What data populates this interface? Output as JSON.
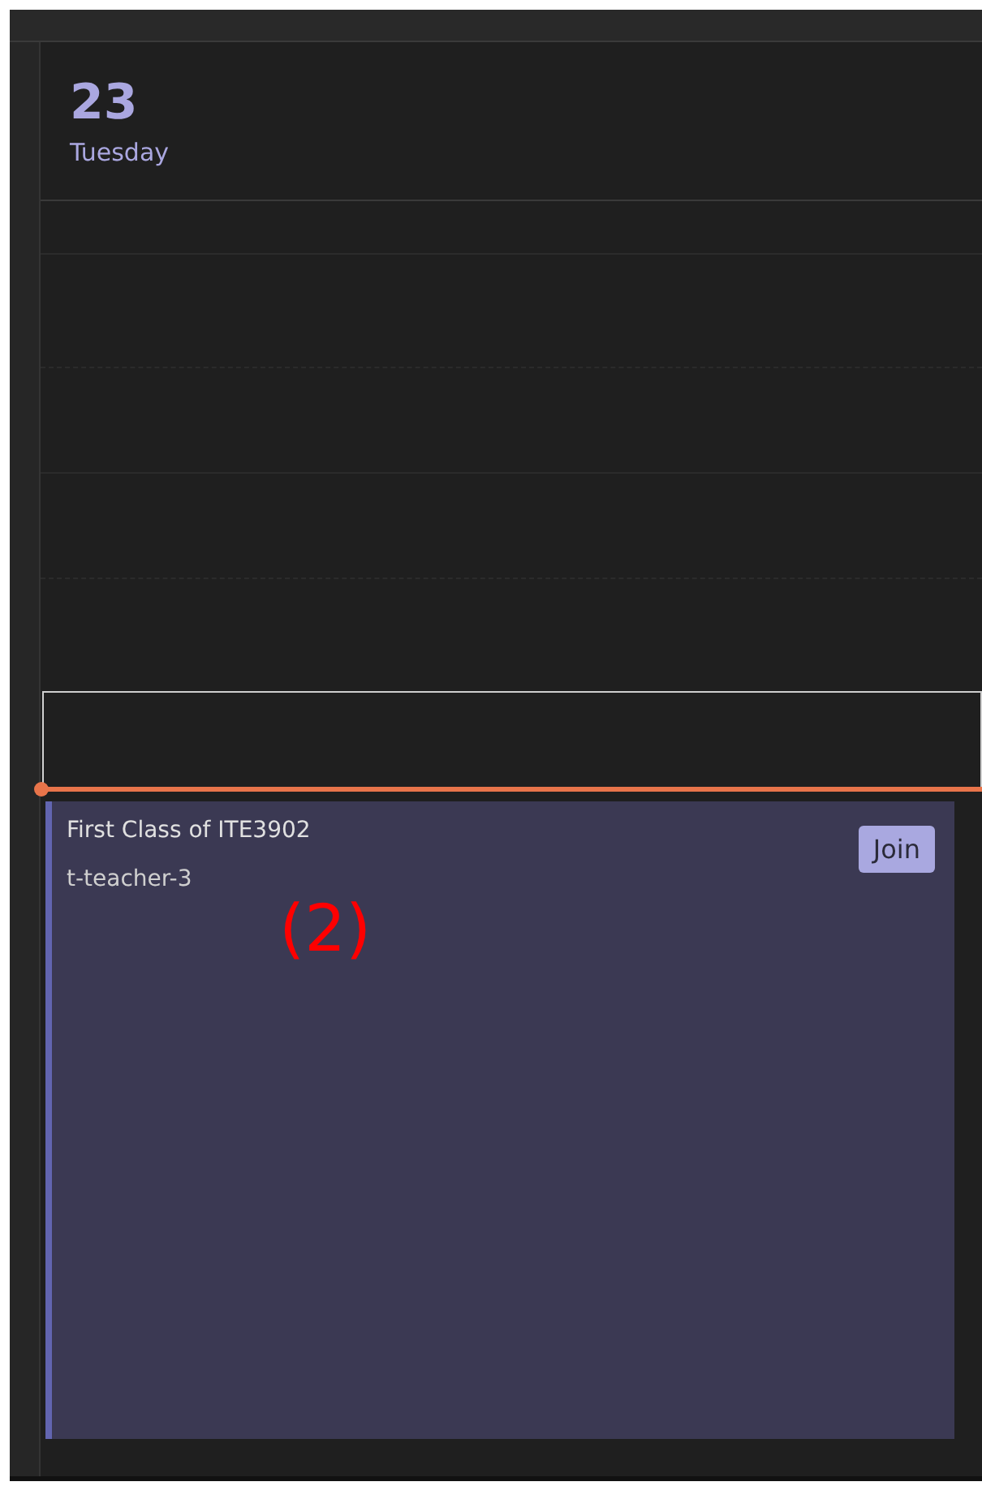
{
  "day": {
    "date": "23",
    "weekday": "Tuesday"
  },
  "event": {
    "title": "First Class of ITE3902",
    "organizer": "t-teacher-3",
    "join_button": "Join"
  },
  "annotation": "(2)"
}
